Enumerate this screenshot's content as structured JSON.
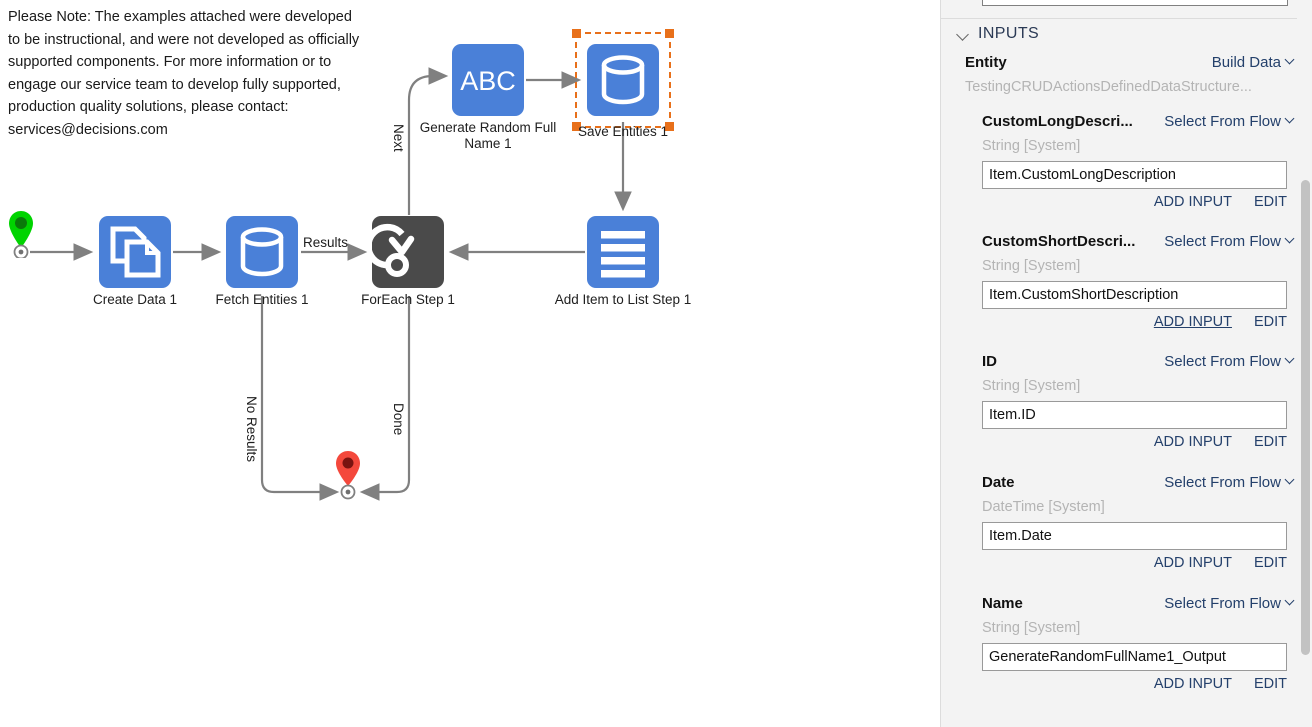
{
  "canvas": {
    "note": "Please Note: The examples attached were developed to be instructional, and were not developed as officially supported components. For more information or to engage our service team to develop fully supported, production quality solutions, please contact: services@decisions.com",
    "nodes": [
      {
        "id": "start",
        "label": "",
        "icon": "start-pin-icon"
      },
      {
        "id": "create-data-1",
        "label": "Create Data 1",
        "icon": "copy-documents-icon"
      },
      {
        "id": "fetch-entities-1",
        "label": "Fetch Entities 1",
        "icon": "database-icon"
      },
      {
        "id": "foreach-step-1",
        "label": "ForEach Step 1",
        "icon": "loop-arrow-icon"
      },
      {
        "id": "generate-random-full-name-1",
        "label": "Generate Random Full Name 1",
        "icon": "abc-icon"
      },
      {
        "id": "save-entities-1",
        "label": "Save Entities 1",
        "icon": "database-icon",
        "selected": true
      },
      {
        "id": "add-item-to-list-step-1",
        "label": "Add Item to List Step 1",
        "icon": "list-rows-icon"
      },
      {
        "id": "end",
        "label": "",
        "icon": "end-pin-icon"
      }
    ],
    "edge_labels": {
      "results": "Results",
      "next": "Next",
      "no_results": "No Results",
      "done": "Done"
    },
    "colors": {
      "node_blue": "#4a80d8",
      "node_dark": "#4a4a4a",
      "selection_orange": "#e8701a",
      "start_green": "#00d400",
      "end_red": "#f4483c",
      "connector_gray": "#808080"
    }
  },
  "panel": {
    "section": {
      "title": "INPUTS",
      "expanded_icon": "chevron-down-icon"
    },
    "entity": {
      "name": "Entity",
      "picker": "Build Data",
      "type": "TestingCRUDActionsDefinedDataStructure..."
    },
    "fields": [
      {
        "name": "CustomLongDescri...",
        "picker": "Select From Flow",
        "type": "String [System]",
        "value": "Item.CustomLongDescription",
        "add_label": "ADD INPUT",
        "edit_label": "EDIT",
        "add_hover": false
      },
      {
        "name": "CustomShortDescri...",
        "picker": "Select From Flow",
        "type": "String [System]",
        "value": "Item.CustomShortDescription",
        "add_label": "ADD INPUT",
        "edit_label": "EDIT",
        "add_hover": true
      },
      {
        "name": "ID",
        "picker": "Select From Flow",
        "type": "String [System]",
        "value": "Item.ID",
        "add_label": "ADD INPUT",
        "edit_label": "EDIT",
        "add_hover": false
      },
      {
        "name": "Date",
        "picker": "Select From Flow",
        "type": "DateTime [System]",
        "value": "Item.Date",
        "add_label": "ADD INPUT",
        "edit_label": "EDIT",
        "add_hover": false
      },
      {
        "name": "Name",
        "picker": "Select From Flow",
        "type": "String [System]",
        "value": "GenerateRandomFullName1_Output",
        "add_label": "ADD INPUT",
        "edit_label": "EDIT",
        "add_hover": false
      }
    ]
  }
}
